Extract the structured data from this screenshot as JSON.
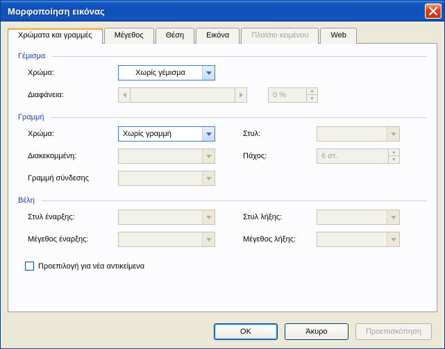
{
  "window": {
    "title": "Μορφοποίηση εικόνας"
  },
  "tabs": {
    "colors_lines": "Χρώματα και γραμμές",
    "size": "Μέγεθος",
    "position": "Θέση",
    "picture": "Εικόνα",
    "textbox": "Πλαίσιο κειμένου",
    "web": "Web"
  },
  "fill": {
    "legend": "Γέμισμα",
    "color_label": "Χρώμα:",
    "color_value": "Χωρίς γέμισμα",
    "transparency_label": "Διαφάνεια:",
    "transparency_value": "0 %"
  },
  "line": {
    "legend": "Γραμμή",
    "color_label": "Χρώμα:",
    "color_value": "Χωρίς γραμμή",
    "style_label": "Στυλ:",
    "dashed_label": "Διακεκομμένη:",
    "weight_label": "Πάχος:",
    "weight_value": "6 στ.",
    "connector_label": "Γραμμή σύνδεσης"
  },
  "arrows": {
    "legend": "Βέλη",
    "begin_style_label": "Στυλ έναρξης:",
    "end_style_label": "Στυλ λήξης:",
    "begin_size_label": "Μέγεθος έναρξης:",
    "end_size_label": "Μέγεθος λήξης:"
  },
  "preselect_label": "Προεπιλογή για νέα αντικείμενα",
  "footer": {
    "ok": "OK",
    "cancel": "Άκυρο",
    "preview": "Προεπισκόπηση"
  }
}
